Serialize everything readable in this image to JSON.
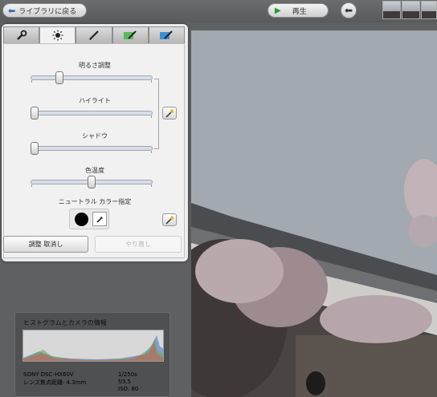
{
  "toolbar": {
    "back_label": "ライブラリに戻る",
    "play_label": "再生"
  },
  "tabs": [
    {
      "icon": "wrench-icon"
    },
    {
      "icon": "brightness-icon"
    },
    {
      "icon": "brush-icon"
    },
    {
      "icon": "green-brush-icon"
    },
    {
      "icon": "blue-brush-icon"
    }
  ],
  "adjust": {
    "brightness_label": "明るさ調整",
    "brightness_value": 0.2,
    "highlight_label": "ハイライト",
    "highlight_value": 0.0,
    "shadow_label": "シャドウ",
    "shadow_value": 0.0,
    "color_temp_label": "色温度",
    "color_temp_value": 0.5,
    "neutral_label": "ニュートラル カラー指定",
    "cancel_button": "調整 取消し",
    "redo_button": "やり直し"
  },
  "info": {
    "title": "ヒストグラムとカメラの情報",
    "camera_model": "SONY DSC-HX60V",
    "focal_length": "レンズ焦点距離: 4.3mm",
    "shutter": "1/250s",
    "aperture": "f/3.5",
    "iso": "ISO: 80"
  }
}
